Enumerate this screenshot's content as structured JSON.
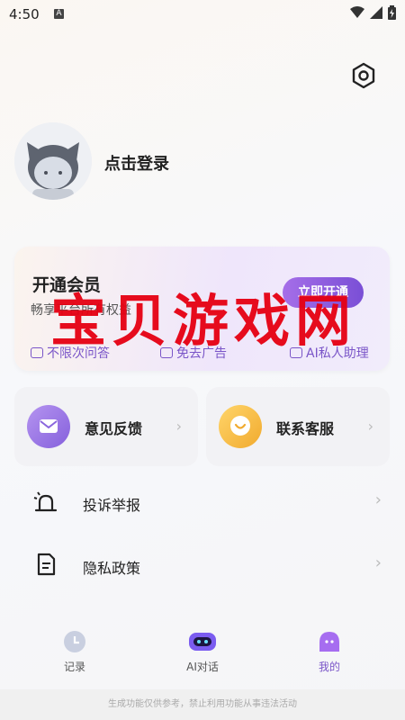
{
  "status": {
    "time": "4:50",
    "indicator": "A"
  },
  "header": {
    "settings_icon": "settings-icon"
  },
  "profile": {
    "login_label": "点击登录"
  },
  "vip": {
    "title": "开通会员",
    "subtitle": "畅享平台所有权益",
    "button": "立即开通",
    "perks": [
      "不限次问答",
      "免去广告",
      "AI私人助理"
    ]
  },
  "tiles": [
    {
      "label": "意见反馈",
      "icon": "mail-icon",
      "color": "#9b7ce8"
    },
    {
      "label": "联系客服",
      "icon": "chat-smile-icon",
      "color": "#f4b942"
    }
  ],
  "menu": [
    {
      "label": "投诉举报",
      "icon": "alarm-icon"
    },
    {
      "label": "隐私政策",
      "icon": "document-icon"
    }
  ],
  "nav": [
    {
      "label": "记录",
      "icon": "clock-icon"
    },
    {
      "label": "AI对话",
      "icon": "robot-icon"
    },
    {
      "label": "我的",
      "icon": "ghost-icon"
    }
  ],
  "footer": {
    "text": "生成功能仅供参考，禁止利用功能从事违法活动"
  },
  "watermark": {
    "text": "宝贝游戏网"
  }
}
